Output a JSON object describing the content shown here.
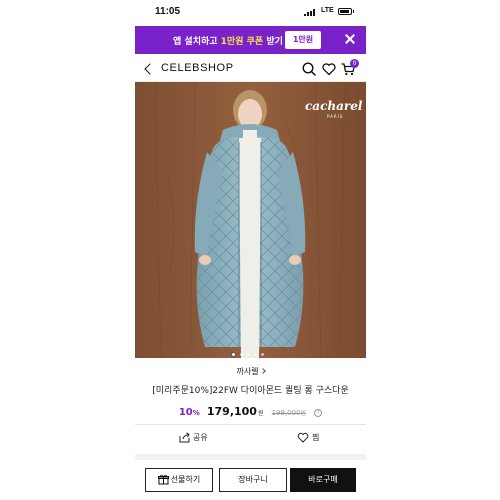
{
  "status": {
    "time": "11:05",
    "network": "LTE"
  },
  "promo": {
    "text_prefix": "앱 설치하고 ",
    "text_highlight": "1만원 쿠폰",
    "text_suffix": " 받기",
    "coupon_label": "1만원",
    "color": "#7a22c9"
  },
  "header": {
    "brand": "CELEBSHOP",
    "cart_count": "0"
  },
  "image": {
    "logo": "cacharel",
    "logo_sub": "PARIS",
    "slide_count": 5,
    "active_slide": 1
  },
  "product": {
    "brand": "까사렐",
    "title": "[미리주문10%]22FW 다이아몬드 퀼팅 롱 구스다운",
    "discount": "10",
    "discount_unit": "%",
    "price": "179,100",
    "currency": "원",
    "original_price": "199,000",
    "original_currency": "원",
    "info": "?"
  },
  "actions": {
    "share": "공유",
    "like": "찜"
  },
  "buttons": {
    "gift": "선물하기",
    "cart": "장바구니",
    "buy": "바로구매"
  }
}
